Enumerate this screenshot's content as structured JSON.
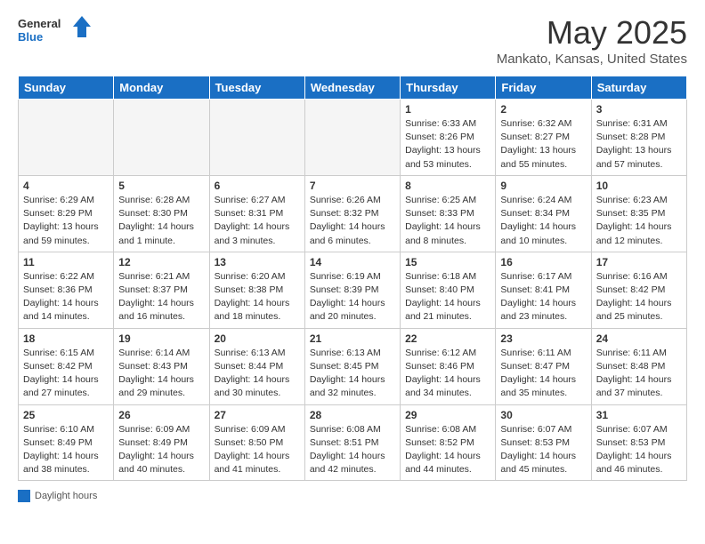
{
  "app": {
    "name": "GeneralBlue",
    "logo_text1": "General",
    "logo_text2": "Blue"
  },
  "calendar": {
    "month_title": "May 2025",
    "location": "Mankato, Kansas, United States",
    "day_headers": [
      "Sunday",
      "Monday",
      "Tuesday",
      "Wednesday",
      "Thursday",
      "Friday",
      "Saturday"
    ],
    "legend_label": "Daylight hours",
    "weeks": [
      [
        {
          "day": "",
          "info": ""
        },
        {
          "day": "",
          "info": ""
        },
        {
          "day": "",
          "info": ""
        },
        {
          "day": "",
          "info": ""
        },
        {
          "day": "1",
          "info": "Sunrise: 6:33 AM\nSunset: 8:26 PM\nDaylight: 13 hours\nand 53 minutes."
        },
        {
          "day": "2",
          "info": "Sunrise: 6:32 AM\nSunset: 8:27 PM\nDaylight: 13 hours\nand 55 minutes."
        },
        {
          "day": "3",
          "info": "Sunrise: 6:31 AM\nSunset: 8:28 PM\nDaylight: 13 hours\nand 57 minutes."
        }
      ],
      [
        {
          "day": "4",
          "info": "Sunrise: 6:29 AM\nSunset: 8:29 PM\nDaylight: 13 hours\nand 59 minutes."
        },
        {
          "day": "5",
          "info": "Sunrise: 6:28 AM\nSunset: 8:30 PM\nDaylight: 14 hours\nand 1 minute."
        },
        {
          "day": "6",
          "info": "Sunrise: 6:27 AM\nSunset: 8:31 PM\nDaylight: 14 hours\nand 3 minutes."
        },
        {
          "day": "7",
          "info": "Sunrise: 6:26 AM\nSunset: 8:32 PM\nDaylight: 14 hours\nand 6 minutes."
        },
        {
          "day": "8",
          "info": "Sunrise: 6:25 AM\nSunset: 8:33 PM\nDaylight: 14 hours\nand 8 minutes."
        },
        {
          "day": "9",
          "info": "Sunrise: 6:24 AM\nSunset: 8:34 PM\nDaylight: 14 hours\nand 10 minutes."
        },
        {
          "day": "10",
          "info": "Sunrise: 6:23 AM\nSunset: 8:35 PM\nDaylight: 14 hours\nand 12 minutes."
        }
      ],
      [
        {
          "day": "11",
          "info": "Sunrise: 6:22 AM\nSunset: 8:36 PM\nDaylight: 14 hours\nand 14 minutes."
        },
        {
          "day": "12",
          "info": "Sunrise: 6:21 AM\nSunset: 8:37 PM\nDaylight: 14 hours\nand 16 minutes."
        },
        {
          "day": "13",
          "info": "Sunrise: 6:20 AM\nSunset: 8:38 PM\nDaylight: 14 hours\nand 18 minutes."
        },
        {
          "day": "14",
          "info": "Sunrise: 6:19 AM\nSunset: 8:39 PM\nDaylight: 14 hours\nand 20 minutes."
        },
        {
          "day": "15",
          "info": "Sunrise: 6:18 AM\nSunset: 8:40 PM\nDaylight: 14 hours\nand 21 minutes."
        },
        {
          "day": "16",
          "info": "Sunrise: 6:17 AM\nSunset: 8:41 PM\nDaylight: 14 hours\nand 23 minutes."
        },
        {
          "day": "17",
          "info": "Sunrise: 6:16 AM\nSunset: 8:42 PM\nDaylight: 14 hours\nand 25 minutes."
        }
      ],
      [
        {
          "day": "18",
          "info": "Sunrise: 6:15 AM\nSunset: 8:42 PM\nDaylight: 14 hours\nand 27 minutes."
        },
        {
          "day": "19",
          "info": "Sunrise: 6:14 AM\nSunset: 8:43 PM\nDaylight: 14 hours\nand 29 minutes."
        },
        {
          "day": "20",
          "info": "Sunrise: 6:13 AM\nSunset: 8:44 PM\nDaylight: 14 hours\nand 30 minutes."
        },
        {
          "day": "21",
          "info": "Sunrise: 6:13 AM\nSunset: 8:45 PM\nDaylight: 14 hours\nand 32 minutes."
        },
        {
          "day": "22",
          "info": "Sunrise: 6:12 AM\nSunset: 8:46 PM\nDaylight: 14 hours\nand 34 minutes."
        },
        {
          "day": "23",
          "info": "Sunrise: 6:11 AM\nSunset: 8:47 PM\nDaylight: 14 hours\nand 35 minutes."
        },
        {
          "day": "24",
          "info": "Sunrise: 6:11 AM\nSunset: 8:48 PM\nDaylight: 14 hours\nand 37 minutes."
        }
      ],
      [
        {
          "day": "25",
          "info": "Sunrise: 6:10 AM\nSunset: 8:49 PM\nDaylight: 14 hours\nand 38 minutes."
        },
        {
          "day": "26",
          "info": "Sunrise: 6:09 AM\nSunset: 8:49 PM\nDaylight: 14 hours\nand 40 minutes."
        },
        {
          "day": "27",
          "info": "Sunrise: 6:09 AM\nSunset: 8:50 PM\nDaylight: 14 hours\nand 41 minutes."
        },
        {
          "day": "28",
          "info": "Sunrise: 6:08 AM\nSunset: 8:51 PM\nDaylight: 14 hours\nand 42 minutes."
        },
        {
          "day": "29",
          "info": "Sunrise: 6:08 AM\nSunset: 8:52 PM\nDaylight: 14 hours\nand 44 minutes."
        },
        {
          "day": "30",
          "info": "Sunrise: 6:07 AM\nSunset: 8:53 PM\nDaylight: 14 hours\nand 45 minutes."
        },
        {
          "day": "31",
          "info": "Sunrise: 6:07 AM\nSunset: 8:53 PM\nDaylight: 14 hours\nand 46 minutes."
        }
      ]
    ]
  }
}
